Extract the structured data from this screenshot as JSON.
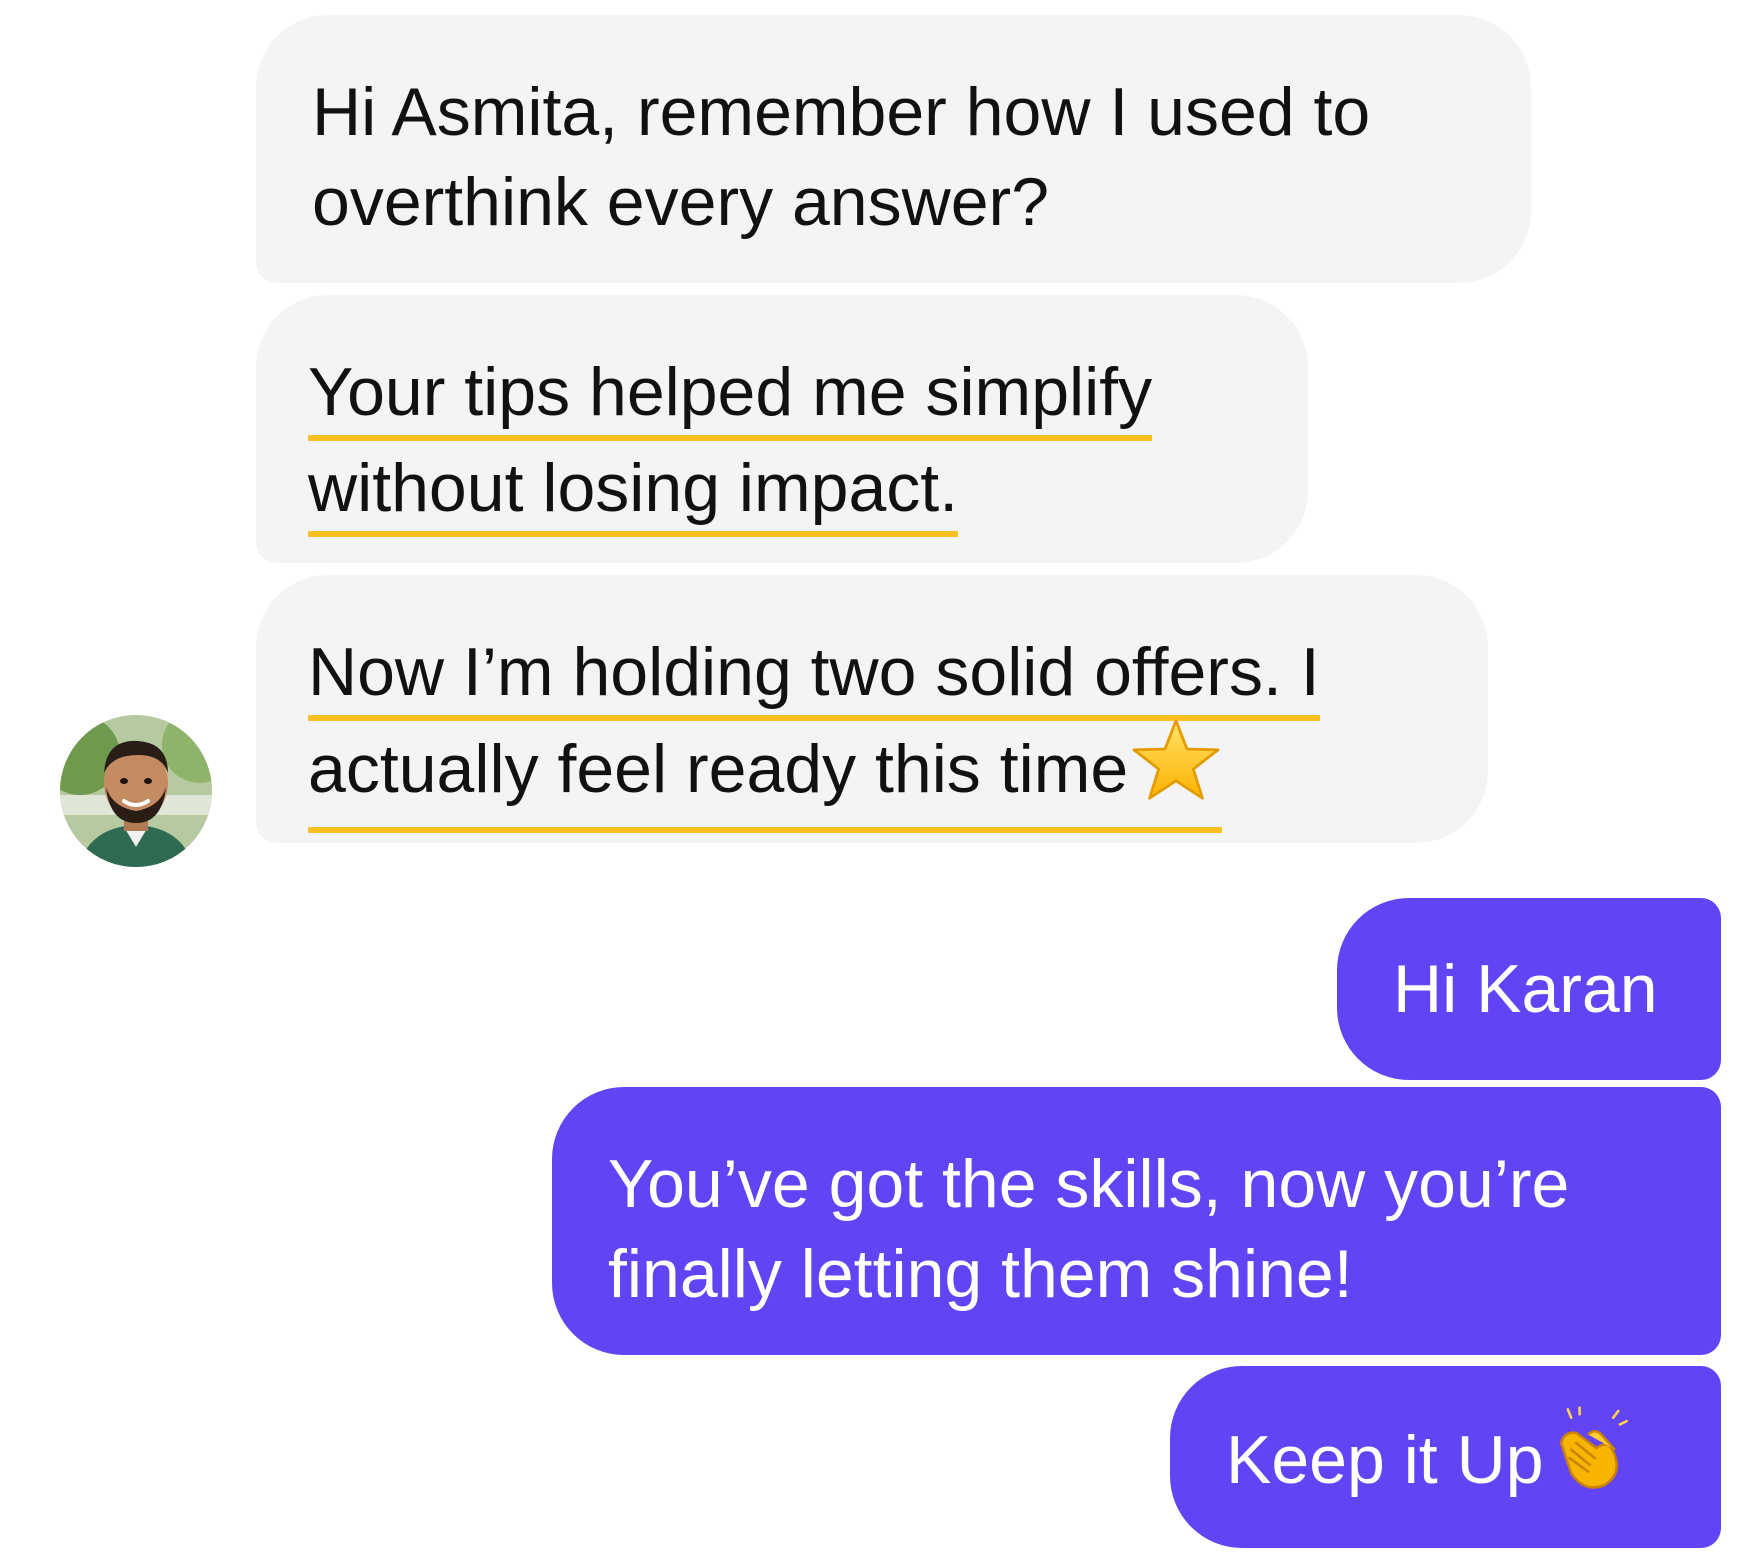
{
  "contact": {
    "avatar_alt": "Karan"
  },
  "messages": {
    "m1": {
      "line1": "Hi Asmita, remember how I used to",
      "line2": "overthink every answer?"
    },
    "m2": {
      "line1": "Your tips helped me simplify",
      "line2": "without losing impact."
    },
    "m3": {
      "line1": "Now I’m holding two solid offers. I",
      "line2": "actually feel ready this time",
      "emoji": "star-emoji"
    },
    "m4": {
      "text": "Hi Karan"
    },
    "m5": {
      "line1": "You’ve got the skills, now you’re",
      "line2": "finally letting them shine!"
    },
    "m6": {
      "text": "Keep it Up",
      "emoji": "clapping-hands-emoji"
    }
  },
  "colors": {
    "incoming_bubble": "#f3f4f6",
    "outgoing_bubble": "#6344f5",
    "highlight_underline": "#fbbf24"
  }
}
